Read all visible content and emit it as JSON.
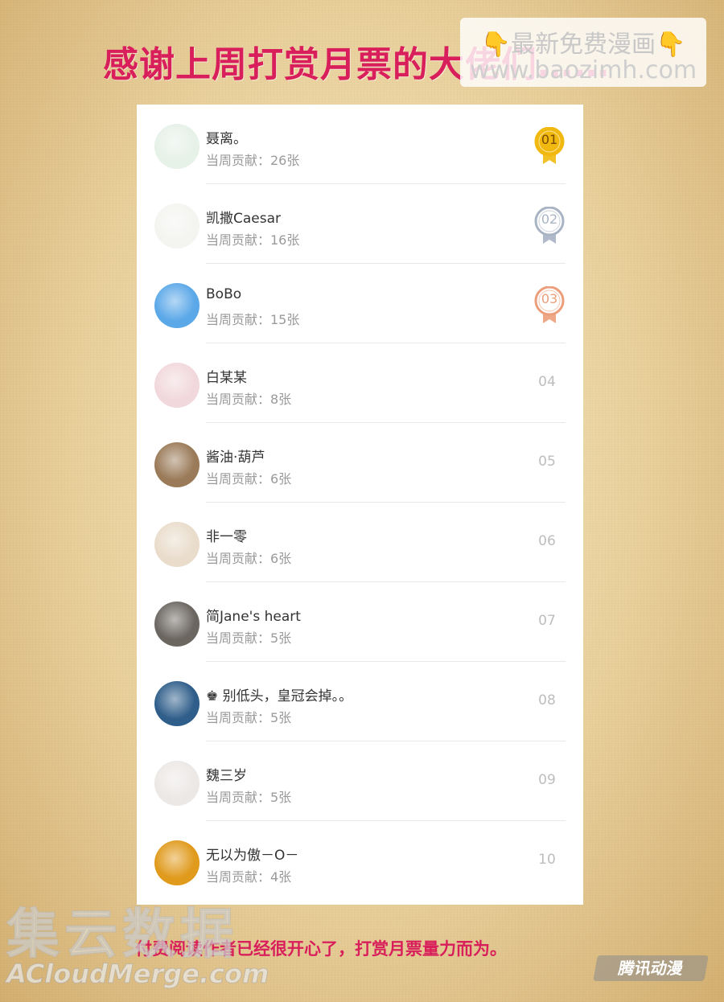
{
  "title": "感谢上周打赏月票的大佬们……",
  "watermark": {
    "line1": "最新免费漫画",
    "line2": "www.baozimh.com"
  },
  "rows": [
    {
      "name": "聂离。",
      "contribution": "当周贡献：26张",
      "rank": "01",
      "medal": "gold",
      "avatar_color": "#e6f1e8"
    },
    {
      "name": "凯撒Caesar",
      "contribution": "当周贡献：16张",
      "rank": "02",
      "medal": "silver",
      "avatar_color": "#f4f4f1"
    },
    {
      "name": "BoBo",
      "contribution": "当周贡献：15张",
      "rank": "03",
      "medal": "bronze",
      "avatar_color": "#5ba8e8"
    },
    {
      "name": "白某某",
      "contribution": "当周贡献：8张",
      "rank": "04",
      "medal": "",
      "avatar_color": "#f1d8dc"
    },
    {
      "name": "酱油·葫芦",
      "contribution": "当周贡献：6张",
      "rank": "05",
      "medal": "",
      "avatar_color": "#9a7a58"
    },
    {
      "name": "非一零",
      "contribution": "当周贡献：6张",
      "rank": "06",
      "medal": "",
      "avatar_color": "#e9dccb"
    },
    {
      "name": "简Jane's heart",
      "contribution": "当周贡献：5张",
      "rank": "07",
      "medal": "",
      "avatar_color": "#6b6660"
    },
    {
      "name": "♚ 别低头，皇冠会掉。。",
      "contribution": "当周贡献：5张",
      "rank": "08",
      "medal": "",
      "avatar_color": "#2f5e8a"
    },
    {
      "name": "魏三岁",
      "contribution": "当周贡献：5张",
      "rank": "09",
      "medal": "",
      "avatar_color": "#ece8e6"
    },
    {
      "name": "无以为傲－O－",
      "contribution": "当周贡献：4张",
      "rank": "10",
      "medal": "",
      "avatar_color": "#e09a1c"
    }
  ],
  "colors": {
    "accent": "#d81e5b",
    "gold": "#f1b90f",
    "silver": "#a8b3c4",
    "bronze": "#ec9e7a"
  },
  "footer": "付费阅读作者已经很开心了，打赏月票量力而为。",
  "logos": {
    "cn": "集云数据",
    "en": "ACloudMerge.com",
    "corner": "腾讯动漫"
  }
}
